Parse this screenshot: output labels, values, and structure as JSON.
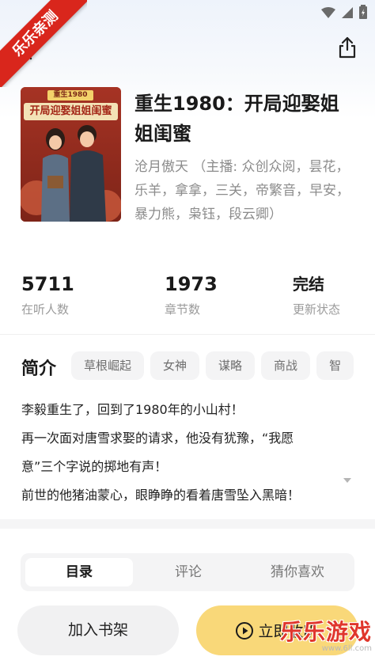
{
  "watermark_ribbon": "乐乐亲测",
  "book": {
    "title": "重生1980：开局迎娶姐姐闺蜜",
    "author": "沧月傲天 （主播: 众创众阅，昙花，乐羊，拿拿，三关，帝繁音，早安，暴力熊，枭钰，段云卿）",
    "cover_banner_small": "重生1980",
    "cover_banner_title": "开局迎娶姐姐闺蜜"
  },
  "stats": [
    {
      "value": "5711",
      "label": "在听人数"
    },
    {
      "value": "1973",
      "label": "章节数"
    },
    {
      "value": "完结",
      "label": "更新状态"
    }
  ],
  "intro": {
    "heading": "简介",
    "tags": [
      "草根崛起",
      "女神",
      "谋略",
      "商战",
      "智"
    ],
    "lines": [
      "李毅重生了，回到了1980年的小山村！",
      "再一次面对唐雪求娶的请求，他没有犹豫，“我愿",
      "意”三个字说的掷地有声！",
      "前世的他猪油蒙心，眼睁睁的看着唐雪坠入黑暗！"
    ]
  },
  "tabs": [
    "目录",
    "评论",
    "猜你喜欢"
  ],
  "actions": {
    "shelf": "加入书架",
    "listen": "立即收听"
  },
  "watermark": {
    "main": "乐乐游戏",
    "sub": "www.6ll.com"
  },
  "colors": {
    "accent": "#f9d879",
    "ribbon": "#d9261c"
  }
}
